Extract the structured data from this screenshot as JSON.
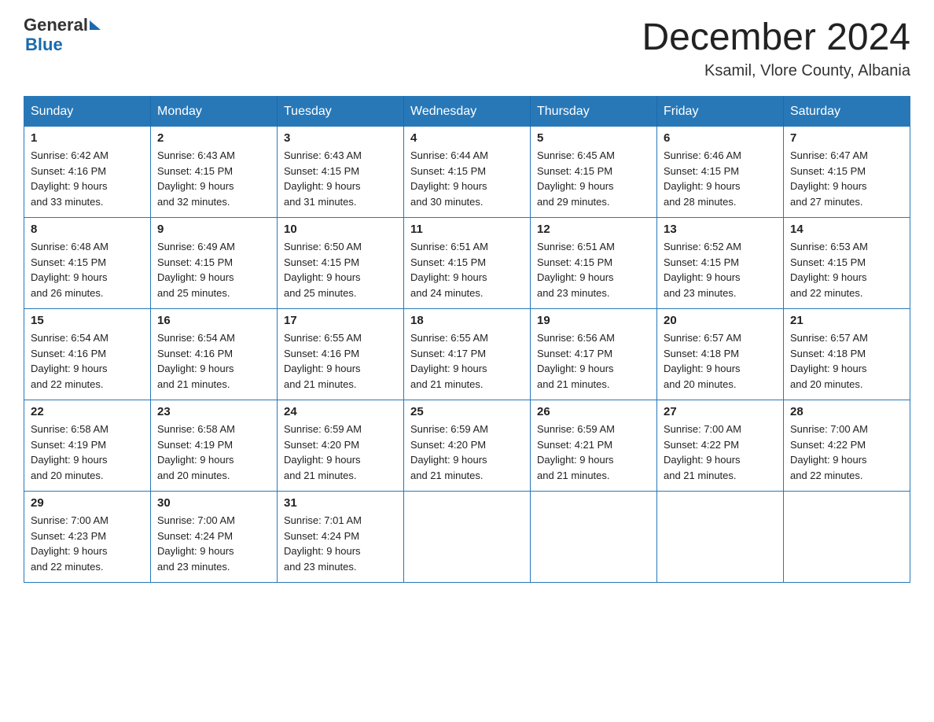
{
  "header": {
    "logo_general": "General",
    "logo_blue": "Blue",
    "month_year": "December 2024",
    "location": "Ksamil, Vlore County, Albania"
  },
  "days_of_week": [
    "Sunday",
    "Monday",
    "Tuesday",
    "Wednesday",
    "Thursday",
    "Friday",
    "Saturday"
  ],
  "weeks": [
    [
      {
        "day": "1",
        "sunrise": "6:42 AM",
        "sunset": "4:16 PM",
        "daylight": "9 hours and 33 minutes."
      },
      {
        "day": "2",
        "sunrise": "6:43 AM",
        "sunset": "4:15 PM",
        "daylight": "9 hours and 32 minutes."
      },
      {
        "day": "3",
        "sunrise": "6:43 AM",
        "sunset": "4:15 PM",
        "daylight": "9 hours and 31 minutes."
      },
      {
        "day": "4",
        "sunrise": "6:44 AM",
        "sunset": "4:15 PM",
        "daylight": "9 hours and 30 minutes."
      },
      {
        "day": "5",
        "sunrise": "6:45 AM",
        "sunset": "4:15 PM",
        "daylight": "9 hours and 29 minutes."
      },
      {
        "day": "6",
        "sunrise": "6:46 AM",
        "sunset": "4:15 PM",
        "daylight": "9 hours and 28 minutes."
      },
      {
        "day": "7",
        "sunrise": "6:47 AM",
        "sunset": "4:15 PM",
        "daylight": "9 hours and 27 minutes."
      }
    ],
    [
      {
        "day": "8",
        "sunrise": "6:48 AM",
        "sunset": "4:15 PM",
        "daylight": "9 hours and 26 minutes."
      },
      {
        "day": "9",
        "sunrise": "6:49 AM",
        "sunset": "4:15 PM",
        "daylight": "9 hours and 25 minutes."
      },
      {
        "day": "10",
        "sunrise": "6:50 AM",
        "sunset": "4:15 PM",
        "daylight": "9 hours and 25 minutes."
      },
      {
        "day": "11",
        "sunrise": "6:51 AM",
        "sunset": "4:15 PM",
        "daylight": "9 hours and 24 minutes."
      },
      {
        "day": "12",
        "sunrise": "6:51 AM",
        "sunset": "4:15 PM",
        "daylight": "9 hours and 23 minutes."
      },
      {
        "day": "13",
        "sunrise": "6:52 AM",
        "sunset": "4:15 PM",
        "daylight": "9 hours and 23 minutes."
      },
      {
        "day": "14",
        "sunrise": "6:53 AM",
        "sunset": "4:15 PM",
        "daylight": "9 hours and 22 minutes."
      }
    ],
    [
      {
        "day": "15",
        "sunrise": "6:54 AM",
        "sunset": "4:16 PM",
        "daylight": "9 hours and 22 minutes."
      },
      {
        "day": "16",
        "sunrise": "6:54 AM",
        "sunset": "4:16 PM",
        "daylight": "9 hours and 21 minutes."
      },
      {
        "day": "17",
        "sunrise": "6:55 AM",
        "sunset": "4:16 PM",
        "daylight": "9 hours and 21 minutes."
      },
      {
        "day": "18",
        "sunrise": "6:55 AM",
        "sunset": "4:17 PM",
        "daylight": "9 hours and 21 minutes."
      },
      {
        "day": "19",
        "sunrise": "6:56 AM",
        "sunset": "4:17 PM",
        "daylight": "9 hours and 21 minutes."
      },
      {
        "day": "20",
        "sunrise": "6:57 AM",
        "sunset": "4:18 PM",
        "daylight": "9 hours and 20 minutes."
      },
      {
        "day": "21",
        "sunrise": "6:57 AM",
        "sunset": "4:18 PM",
        "daylight": "9 hours and 20 minutes."
      }
    ],
    [
      {
        "day": "22",
        "sunrise": "6:58 AM",
        "sunset": "4:19 PM",
        "daylight": "9 hours and 20 minutes."
      },
      {
        "day": "23",
        "sunrise": "6:58 AM",
        "sunset": "4:19 PM",
        "daylight": "9 hours and 20 minutes."
      },
      {
        "day": "24",
        "sunrise": "6:59 AM",
        "sunset": "4:20 PM",
        "daylight": "9 hours and 21 minutes."
      },
      {
        "day": "25",
        "sunrise": "6:59 AM",
        "sunset": "4:20 PM",
        "daylight": "9 hours and 21 minutes."
      },
      {
        "day": "26",
        "sunrise": "6:59 AM",
        "sunset": "4:21 PM",
        "daylight": "9 hours and 21 minutes."
      },
      {
        "day": "27",
        "sunrise": "7:00 AM",
        "sunset": "4:22 PM",
        "daylight": "9 hours and 21 minutes."
      },
      {
        "day": "28",
        "sunrise": "7:00 AM",
        "sunset": "4:22 PM",
        "daylight": "9 hours and 22 minutes."
      }
    ],
    [
      {
        "day": "29",
        "sunrise": "7:00 AM",
        "sunset": "4:23 PM",
        "daylight": "9 hours and 22 minutes."
      },
      {
        "day": "30",
        "sunrise": "7:00 AM",
        "sunset": "4:24 PM",
        "daylight": "9 hours and 23 minutes."
      },
      {
        "day": "31",
        "sunrise": "7:01 AM",
        "sunset": "4:24 PM",
        "daylight": "9 hours and 23 minutes."
      },
      null,
      null,
      null,
      null
    ]
  ]
}
